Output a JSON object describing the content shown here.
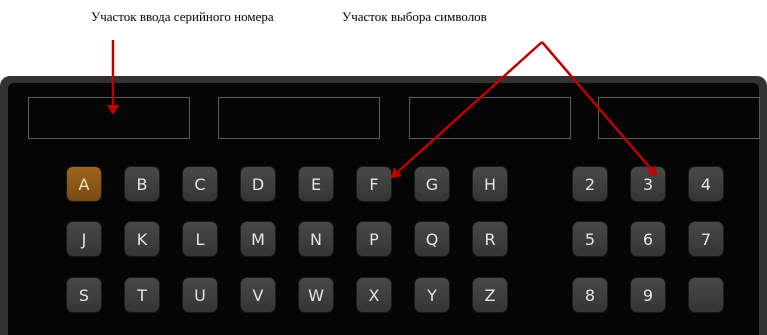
{
  "captions": {
    "serial_area": "Участок ввода серийного номера",
    "char_area": "Участок выбора символов"
  },
  "keyboard": {
    "letters": [
      [
        "A",
        "B",
        "C",
        "D",
        "E",
        "F",
        "G",
        "H"
      ],
      [
        "J",
        "K",
        "L",
        "M",
        "N",
        "P",
        "Q",
        "R"
      ],
      [
        "S",
        "T",
        "U",
        "V",
        "W",
        "X",
        "Y",
        "Z"
      ]
    ],
    "digits": [
      [
        "2",
        "3",
        "4"
      ],
      [
        "5",
        "6",
        "7"
      ],
      [
        "8",
        "9",
        ""
      ]
    ],
    "selected": "A"
  },
  "colors": {
    "panel_border": "#323232",
    "panel_bg": "#050505",
    "key_bg": "#404040",
    "key_selected_bg": "#8e5817",
    "arrow": "#c00000"
  }
}
